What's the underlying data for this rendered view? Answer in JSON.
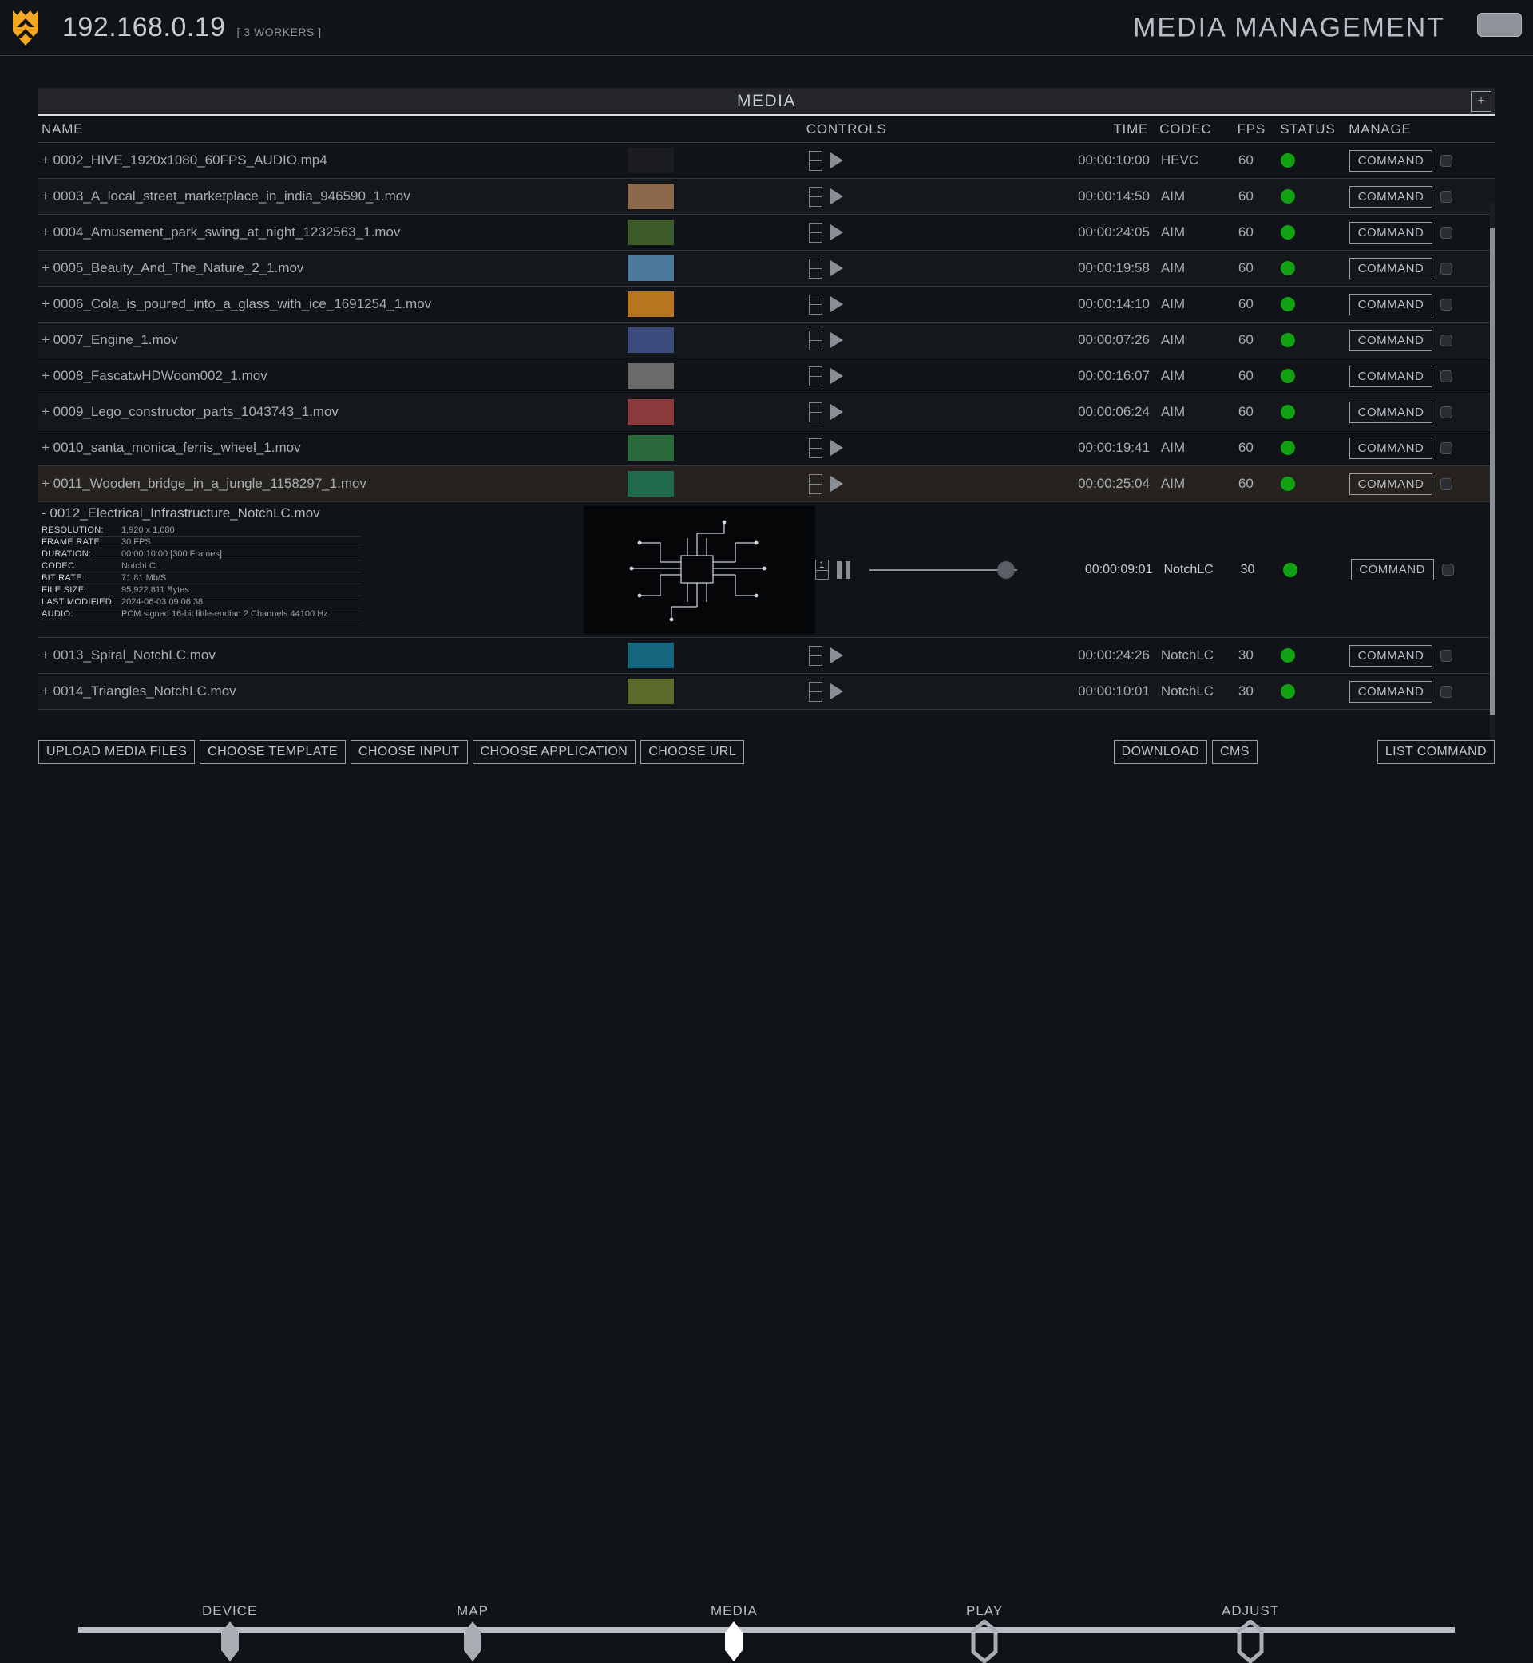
{
  "header": {
    "ip": "192.168.0.19",
    "workers_prefix": "[ 3 ",
    "workers_link": "WORKERS",
    "workers_suffix": " ]",
    "title": "MEDIA MANAGEMENT",
    "logo_icon": "hive-shield-icon",
    "accent_color": "#f5a623"
  },
  "panel": {
    "title": "MEDIA",
    "add_label": "+"
  },
  "columns": {
    "name": "NAME",
    "controls": "CONTROLS",
    "time": "TIME",
    "codec": "CODEC",
    "fps": "FPS",
    "status": "STATUS",
    "manage": "MANAGE"
  },
  "status_color": "#12a112",
  "command_label": "COMMAND",
  "rows": [
    {
      "expander": "+",
      "name": "0002_HIVE_1920x1080_60FPS_AUDIO.mp4",
      "time": "00:00:10:00",
      "codec": "HEVC",
      "fps": "60",
      "status": "online",
      "thumb": "#1b1c20",
      "highlight": false
    },
    {
      "expander": "+",
      "name": "0003_A_local_street_marketplace_in_india_946590_1.mov",
      "time": "00:00:14:50",
      "codec": "AIM",
      "fps": "60",
      "status": "online",
      "thumb": "#8a6a4a",
      "highlight": false
    },
    {
      "expander": "+",
      "name": "0004_Amusement_park_swing_at_night_1232563_1.mov",
      "time": "00:00:24:05",
      "codec": "AIM",
      "fps": "60",
      "status": "online",
      "thumb": "#3c5a2a",
      "highlight": false
    },
    {
      "expander": "+",
      "name": "0005_Beauty_And_The_Nature_2_1.mov",
      "time": "00:00:19:58",
      "codec": "AIM",
      "fps": "60",
      "status": "online",
      "thumb": "#4b7a9c",
      "highlight": false
    },
    {
      "expander": "+",
      "name": "0006_Cola_is_poured_into_a_glass_with_ice_1691254_1.mov",
      "time": "00:00:14:10",
      "codec": "AIM",
      "fps": "60",
      "status": "online",
      "thumb": "#b5761f",
      "highlight": false
    },
    {
      "expander": "+",
      "name": "0007_Engine_1.mov",
      "time": "00:00:07:26",
      "codec": "AIM",
      "fps": "60",
      "status": "online",
      "thumb": "#3a4a7a",
      "highlight": false
    },
    {
      "expander": "+",
      "name": "0008_FascatwHDWoom002_1.mov",
      "time": "00:00:16:07",
      "codec": "AIM",
      "fps": "60",
      "status": "online",
      "thumb": "#6a6a6a",
      "highlight": false
    },
    {
      "expander": "+",
      "name": "0009_Lego_constructor_parts_1043743_1.mov",
      "time": "00:00:06:24",
      "codec": "AIM",
      "fps": "60",
      "status": "online",
      "thumb": "#8a3a3a",
      "highlight": false
    },
    {
      "expander": "+",
      "name": "0010_santa_monica_ferris_wheel_1.mov",
      "time": "00:00:19:41",
      "codec": "AIM",
      "fps": "60",
      "status": "online",
      "thumb": "#2a6a3a",
      "highlight": false
    },
    {
      "expander": "+",
      "name": "0011_Wooden_bridge_in_a_jungle_1158297_1.mov",
      "time": "00:00:25:04",
      "codec": "AIM",
      "fps": "60",
      "status": "online",
      "thumb": "#1f6a4a",
      "highlight": true
    }
  ],
  "expanded_row": {
    "expander": "-",
    "name": "0012_Electrical_Infrastructure_NotchLC.mov",
    "time": "00:00:09:01",
    "codec": "NotchLC",
    "fps": "30",
    "status": "online",
    "frame_field": "1",
    "meta": [
      {
        "key": "RESOLUTION:",
        "value": "1,920 x 1,080"
      },
      {
        "key": "FRAME RATE:",
        "value": "30 FPS"
      },
      {
        "key": "DURATION:",
        "value": "00:00:10:00 [300 Frames]"
      },
      {
        "key": "CODEC:",
        "value": "NotchLC"
      },
      {
        "key": "BIT RATE:",
        "value": "71.81 Mb/S"
      },
      {
        "key": "FILE SIZE:",
        "value": "95,922,811 Bytes"
      },
      {
        "key": "LAST MODIFIED:",
        "value": "2024-06-03 09:06:38"
      },
      {
        "key": "AUDIO:",
        "value": "PCM signed 16-bit little-endian 2 Channels 44100 Hz"
      }
    ]
  },
  "rows_after": [
    {
      "expander": "+",
      "name": "0013_Spiral_NotchLC.mov",
      "time": "00:00:24:26",
      "codec": "NotchLC",
      "fps": "30",
      "status": "online",
      "thumb": "#13667d",
      "highlight": false
    },
    {
      "expander": "+",
      "name": "0014_Triangles_NotchLC.mov",
      "time": "00:00:10:01",
      "codec": "NotchLC",
      "fps": "30",
      "status": "online",
      "thumb": "#5a6a2a",
      "highlight": false
    }
  ],
  "actions": {
    "left": [
      {
        "label": "UPLOAD MEDIA FILES"
      },
      {
        "label": "CHOOSE TEMPLATE"
      },
      {
        "label": "CHOOSE INPUT"
      },
      {
        "label": "CHOOSE APPLICATION"
      },
      {
        "label": "CHOOSE URL"
      }
    ],
    "middle": [
      {
        "label": "DOWNLOAD"
      },
      {
        "label": "CMS"
      }
    ],
    "right": [
      {
        "label": "LIST COMMAND"
      }
    ]
  },
  "wizard": {
    "steps": [
      {
        "label": "DEVICE",
        "state": "done"
      },
      {
        "label": "MAP",
        "state": "done"
      },
      {
        "label": "MEDIA",
        "state": "active"
      },
      {
        "label": "PLAY",
        "state": "todo"
      },
      {
        "label": "ADJUST",
        "state": "todo"
      }
    ]
  }
}
